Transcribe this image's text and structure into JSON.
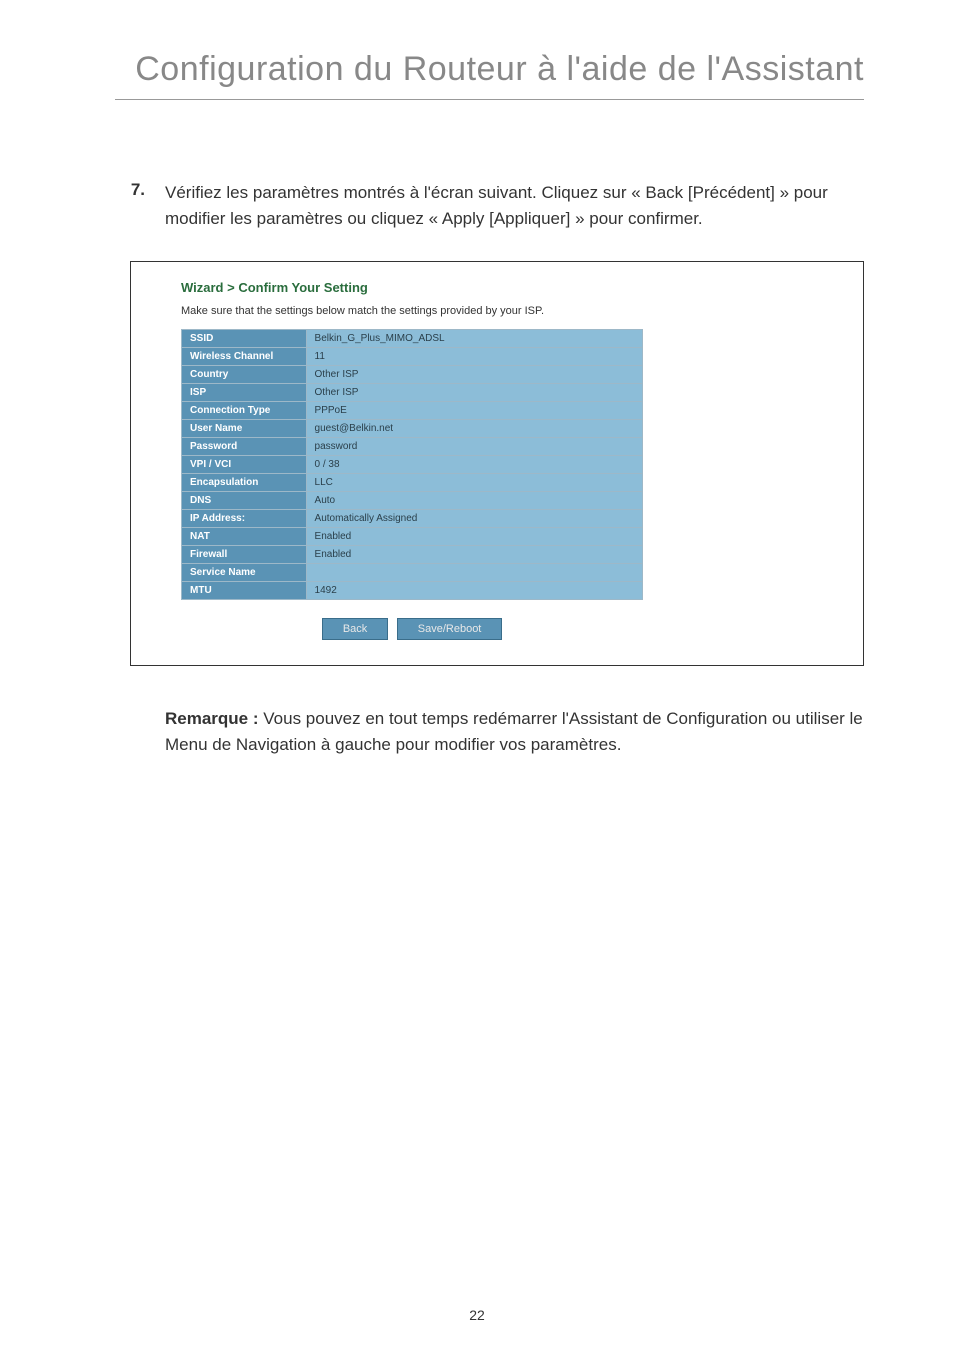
{
  "page_title": "Configuration du Routeur à l'aide de l'Assistant",
  "step": {
    "number": "7.",
    "text": "Vérifiez les paramètres montrés à l'écran suivant. Cliquez sur « Back [Précédent] » pour modifier les paramètres ou cliquez « Apply [Appliquer] » pour confirmer."
  },
  "wizard": {
    "title": "Wizard > Confirm Your Setting",
    "subtitle": "Make sure that the settings below match the settings provided by your ISP.",
    "rows": [
      {
        "label": "SSID",
        "value": "Belkin_G_Plus_MIMO_ADSL"
      },
      {
        "label": "Wireless Channel",
        "value": "11"
      },
      {
        "label": "Country",
        "value": "Other ISP"
      },
      {
        "label": "ISP",
        "value": "Other ISP"
      },
      {
        "label": "Connection Type",
        "value": "PPPoE"
      },
      {
        "label": "User Name",
        "value": "guest@Belkin.net"
      },
      {
        "label": "Password",
        "value": "password"
      },
      {
        "label": "VPI / VCI",
        "value": "0 / 38"
      },
      {
        "label": "Encapsulation",
        "value": "LLC"
      },
      {
        "label": "DNS",
        "value": "Auto"
      },
      {
        "label": "IP Address:",
        "value": "Automatically Assigned"
      },
      {
        "label": "NAT",
        "value": "Enabled"
      },
      {
        "label": "Firewall",
        "value": "Enabled"
      },
      {
        "label": "Service Name",
        "value": ""
      },
      {
        "label": "MTU",
        "value": "1492"
      }
    ],
    "buttons": {
      "back": "Back",
      "save": "Save/Reboot"
    }
  },
  "remark": {
    "label": "Remarque :",
    "text": " Vous pouvez en tout temps redémarrer l'Assistant de Configuration ou utiliser le Menu de Navigation à gauche pour modifier vos paramètres."
  },
  "page_number": "22"
}
